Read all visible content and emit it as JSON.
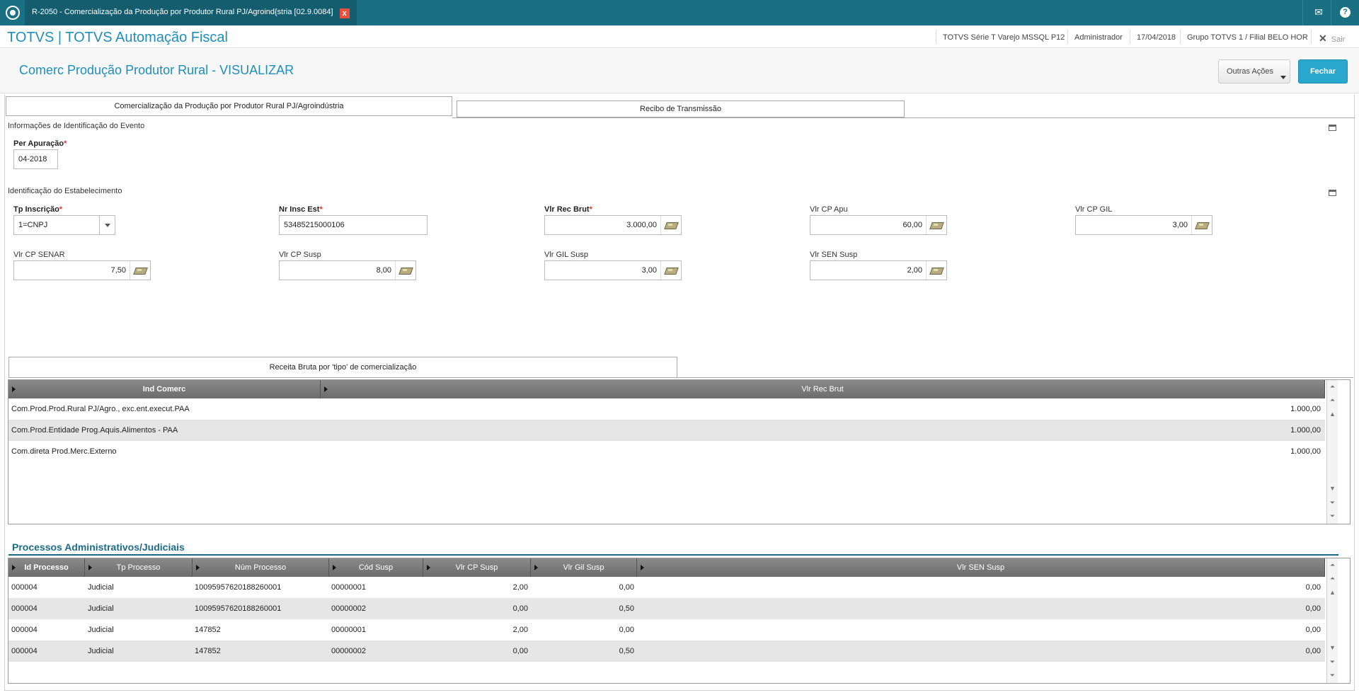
{
  "window": {
    "tab_title": "R-2050 - Comercialização da Produção por Produtor Rural PJ/Agroind{stria [02.9.0084]",
    "close_glyph": "x"
  },
  "header": {
    "brand": "TOTVS | TOTVS Automação Fiscal",
    "environment": "TOTVS Série T Varejo MSSQL P12",
    "user": "Administrador",
    "date": "17/04/2018",
    "company": "Grupo TOTVS 1 / Filial BELO HOR",
    "logout": "Sair"
  },
  "page": {
    "title": "Comerc Produção Produtor Rural - VISUALIZAR",
    "other_actions": "Outras Ações",
    "close": "Fechar"
  },
  "tabs": [
    {
      "label": "Comercialização da Produção por Produtor Rural PJ/Agroindústria",
      "active": true
    },
    {
      "label": "Recibo de Transmissão",
      "active": false
    }
  ],
  "event_section": {
    "title": "Informações de Identificação do Evento",
    "per_apuracao_label": "Per Apuração",
    "per_apuracao_value": "04-2018"
  },
  "establishment_section": {
    "title": "Identificação do Estabelecimento",
    "tp_inscricao_label": "Tp Inscrição",
    "tp_inscricao_value": "1=CNPJ",
    "nr_insc_est_label": "Nr Insc Est",
    "nr_insc_est_value": "53485215000106",
    "vlr_rec_brut_label": "Vlr Rec Brut",
    "vlr_rec_brut_value": "3.000,00",
    "vlr_cp_apu_label": "Vlr CP Apu",
    "vlr_cp_apu_value": "60,00",
    "vlr_cp_gil_label": "Vlr CP GIL",
    "vlr_cp_gil_value": "3,00",
    "vlr_cp_senar_label": "Vlr CP SENAR",
    "vlr_cp_senar_value": "7,50",
    "vlr_cp_susp_label": "Vlr CP Susp",
    "vlr_cp_susp_value": "8,00",
    "vlr_gil_susp_label": "Vlr GIL Susp",
    "vlr_gil_susp_value": "3,00",
    "vlr_sen_susp_label": "Vlr SEN Susp",
    "vlr_sen_susp_value": "2,00",
    "required_mark": "*"
  },
  "receita_grid": {
    "tab_label": "Receita Bruta por 'tipo' de comercialização",
    "columns": [
      "Ind Comerc",
      "Vlr Rec Brut"
    ],
    "rows": [
      [
        "Com.Prod.Prod.Rural PJ/Agro., exc.ent.execut.PAA",
        "1.000,00"
      ],
      [
        "Com.Prod.Entidade Prog.Aquis.Alimentos - PAA",
        "1.000,00"
      ],
      [
        "Com.direta Prod.Merc.Externo",
        "1.000,00"
      ]
    ]
  },
  "processos_grid": {
    "title": "Processos Administrativos/Judiciais",
    "columns": [
      "Id Processo",
      "Tp Processo",
      "Núm Processo",
      "Cód Susp",
      "Vlr CP Susp",
      "Vlr Gil Susp",
      "Vlr SEN Susp"
    ],
    "rows": [
      [
        "000004",
        "Judicial",
        "10095957620188260001",
        "00000001",
        "2,00",
        "0,00",
        "0,00"
      ],
      [
        "000004",
        "Judicial",
        "10095957620188260001",
        "00000002",
        "0,00",
        "0,50",
        "0,00"
      ],
      [
        "000004",
        "Judicial",
        "147852",
        "00000001",
        "2,00",
        "0,00",
        "0,00"
      ],
      [
        "000004",
        "Judicial",
        "147852",
        "00000002",
        "0,00",
        "0,50",
        "0,00"
      ]
    ]
  },
  "colors": {
    "topbar": "#1b6f83",
    "brand": "#1f8ebc",
    "primary_button": "#2aa7cc",
    "section_title": "#1a6b8a"
  },
  "icons": {
    "logo": "totvs-logo-icon",
    "mail": "mail-icon",
    "help": "help-icon",
    "minimize": "minimize-icon",
    "calculator": "calculator-icon"
  }
}
